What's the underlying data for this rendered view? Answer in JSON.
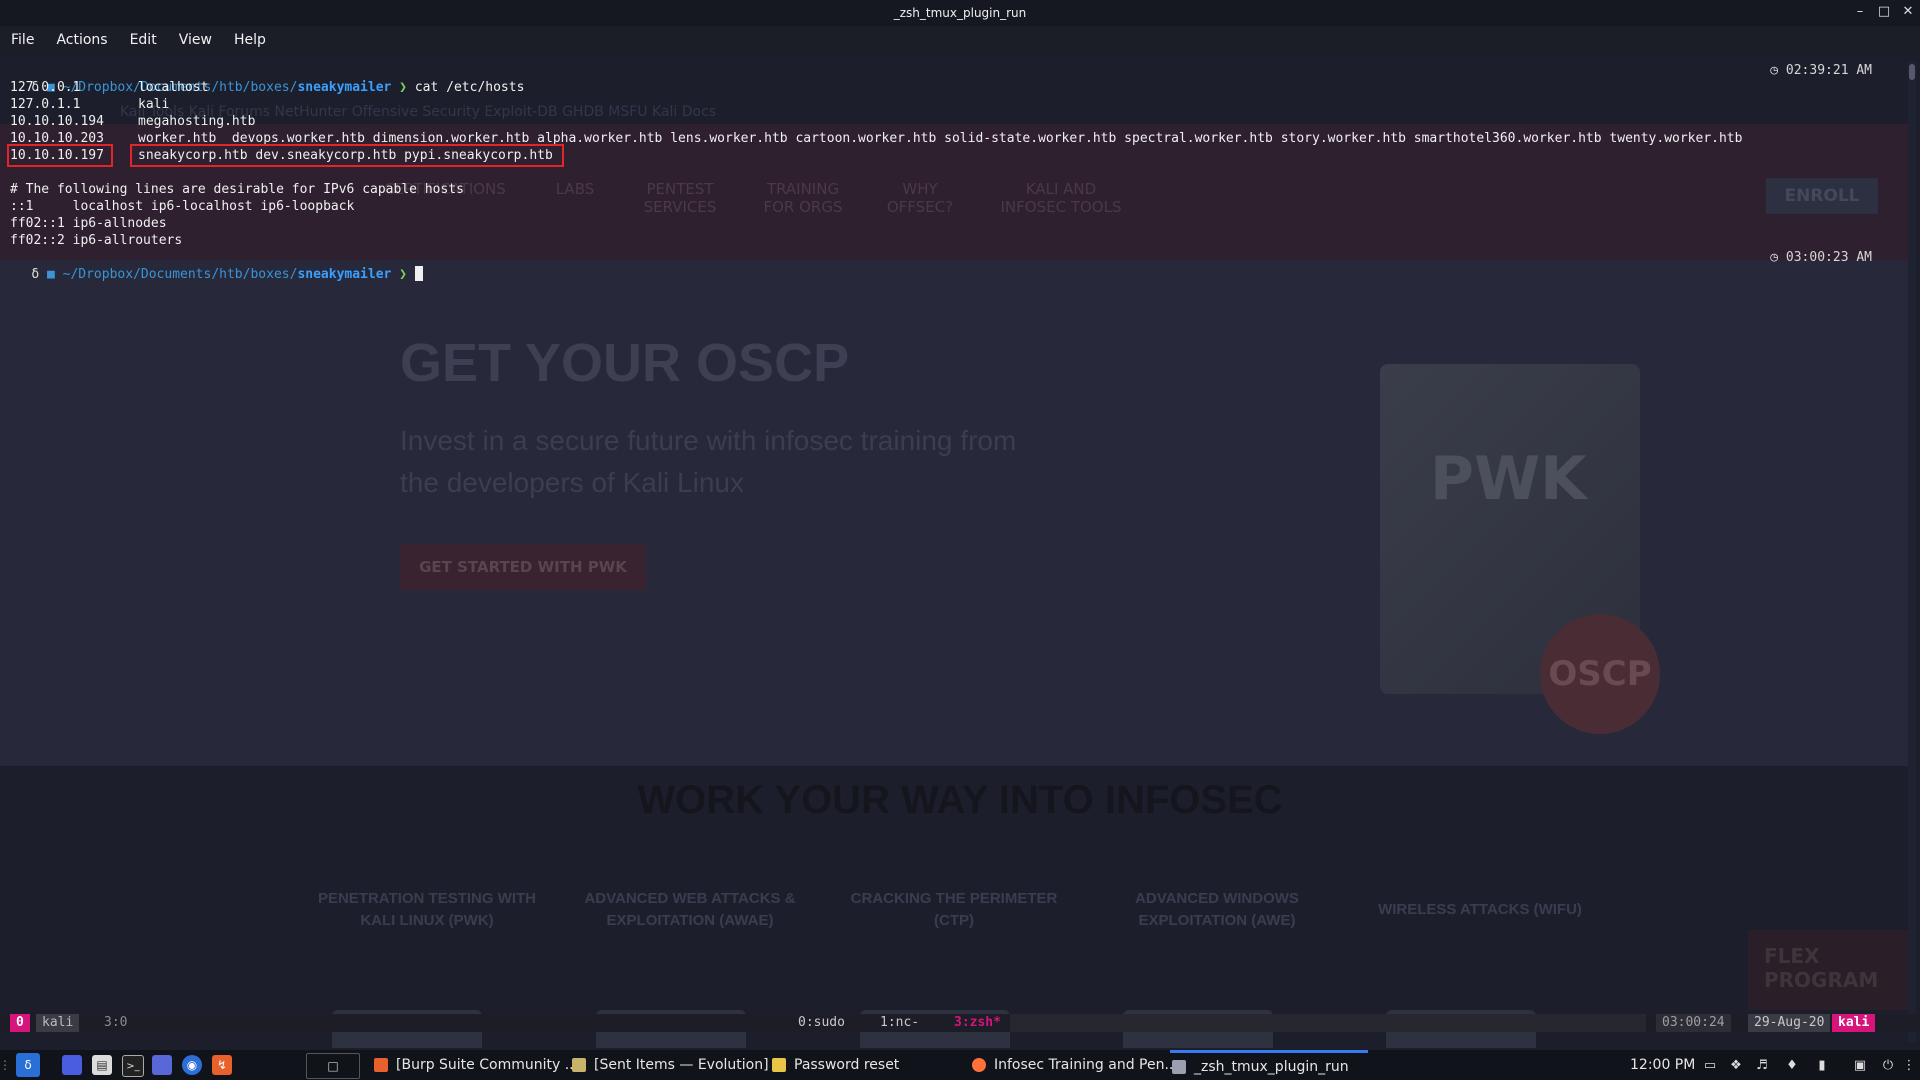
{
  "window": {
    "title": "_zsh_tmux_plugin_run",
    "controls": [
      "–",
      "□",
      "✕"
    ]
  },
  "menu": [
    "File",
    "Actions",
    "Edit",
    "View",
    "Help"
  ],
  "background_page": {
    "bookmarks": "Kali Tools    Kali Forums    NetHunter    Offensive Security    Exploit-DB    GHDB    MSFU    Kali Docs",
    "nav": [
      "CERTIFICATIONS",
      "LABS",
      "PENTEST SERVICES",
      "TRAINING FOR ORGS",
      "WHY OFFSEC?",
      "KALI AND INFOSEC TOOLS"
    ],
    "enroll": "ENROLL",
    "hero_title": "GET YOUR OSCP",
    "hero_sub": "Invest in a secure future with infosec training from the developers of Kali Linux",
    "hero_button": "GET STARTED WITH PWK",
    "box_label": "PWK",
    "badge": "OSCP",
    "section_heading": "WORK YOUR WAY INTO INFOSEC",
    "courses": [
      "PENETRATION TESTING WITH KALI LINUX (PWK)",
      "ADVANCED WEB ATTACKS & EXPLOITATION (AWAE)",
      "CRACKING THE PERIMETER (CTP)",
      "ADVANCED WINDOWS EXPLOITATION (AWE)",
      "WIRELESS ATTACKS (WIFU)"
    ],
    "flex": "FLEX PROGRAM"
  },
  "terminal": {
    "prompt1": {
      "path_prefix": "~/Dropbox/Documents/htb/boxes/",
      "dir": "sneakymailer",
      "command": "cat /etc/hosts",
      "time": "02:39:21 AM"
    },
    "hosts": [
      {
        "ip": "127.0.0.1",
        "names": "localhost"
      },
      {
        "ip": "127.0.1.1",
        "names": "kali"
      },
      {
        "ip": "10.10.10.194",
        "names": "megahosting.htb"
      },
      {
        "ip": "10.10.10.203",
        "names": "worker.htb  devops.worker.htb dimension.worker.htb alpha.worker.htb lens.worker.htb cartoon.worker.htb solid-state.worker.htb spectral.worker.htb story.worker.htb smarthotel360.worker.htb twenty.worker.htb"
      },
      {
        "ip": "10.10.10.197",
        "names": "sneakycorp.htb dev.sneakycorp.htb pypi.sneakycorp.htb"
      }
    ],
    "ipv6_comment": "# The following lines are desirable for IPv6 capable hosts",
    "ipv6": [
      "::1     localhost ip6-localhost ip6-loopback",
      "ff02::1 ip6-allnodes",
      "ff02::2 ip6-allrouters"
    ],
    "prompt2": {
      "path_prefix": "~/Dropbox/Documents/htb/boxes/",
      "dir": "sneakymailer",
      "time": "03:00:23 AM"
    }
  },
  "tmux": {
    "session_index": "0",
    "host": "kali",
    "pane": "3:0",
    "windows": [
      "0:sudo",
      "1:nc-",
      "3:zsh*"
    ],
    "time": "03:00:24",
    "date": "29-Aug-20",
    "hostname": "kali"
  },
  "taskbar": {
    "tasks": [
      {
        "label": "[Burp Suite Community ...",
        "color": "#e8602c"
      },
      {
        "label": "[Sent Items — Evolution]",
        "color": "#c9b26a"
      },
      {
        "label": "Password reset",
        "color": "#e8c547"
      },
      {
        "label": "Infosec Training and Pen...",
        "color": "#ff7139"
      },
      {
        "label": "_zsh_tmux_plugin_run",
        "color": "#9aa0b0"
      }
    ],
    "clock": "12:00 PM",
    "accent": "#367bf0"
  }
}
